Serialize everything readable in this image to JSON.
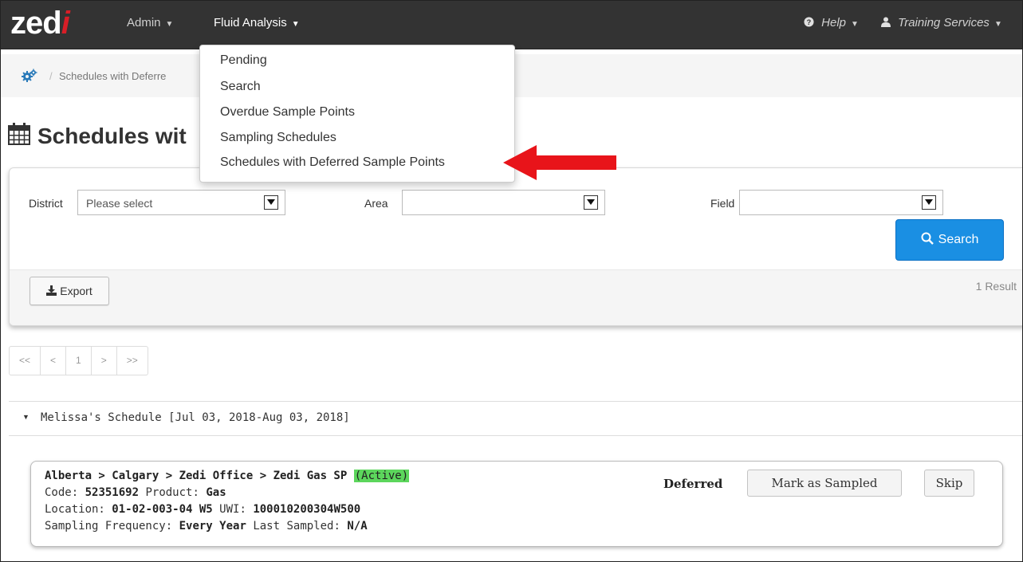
{
  "brand": {
    "logo_main": "zed",
    "logo_accent": "i"
  },
  "nav": {
    "admin": "Admin",
    "fluid": "Fluid Analysis",
    "help": "Help",
    "user": "Training Services"
  },
  "menu": {
    "items": [
      "Pending",
      "Search",
      "Overdue Sample Points",
      "Sampling Schedules",
      "Schedules with Deferred Sample Points"
    ]
  },
  "breadcrumb": {
    "sep": "/",
    "current": "Schedules with Deferre"
  },
  "page": {
    "title": "Schedules wit"
  },
  "filters": {
    "district_label": "District",
    "district_value": "Please select",
    "area_label": "Area",
    "area_value": "",
    "field_label": "Field",
    "field_value": "",
    "search_label": "Search",
    "export_label": "Export",
    "result_count": "1 Result"
  },
  "pagination": [
    "<<",
    "<",
    "1",
    ">",
    ">>"
  ],
  "schedule": {
    "title": "Melissa's Schedule [Jul 03, 2018-Aug 03, 2018]",
    "card": {
      "path": "Alberta > Calgary > Zedi Office > Zedi Gas SP",
      "active_badge": "(Active)",
      "code_label": "Code:",
      "code_value": "52351692",
      "product_label": "Product:",
      "product_value": "Gas",
      "location_label": "Location:",
      "location_value": "01-02-003-04 W5",
      "uwi_label": "UWI:",
      "uwi_value": "100010200304W500",
      "freq_label": "Sampling Frequency:",
      "freq_value": "Every Year",
      "last_label": "Last Sampled:",
      "last_value": "N/A",
      "status": "Deferred",
      "mark_button": "Mark as Sampled",
      "skip_button": "Skip"
    }
  },
  "colors": {
    "navbar": "#333333",
    "logo_accent": "#d81e27",
    "search_button": "#1a8fe3",
    "active_badge": "#5cd65c",
    "annotation_arrow": "#e8141a"
  }
}
